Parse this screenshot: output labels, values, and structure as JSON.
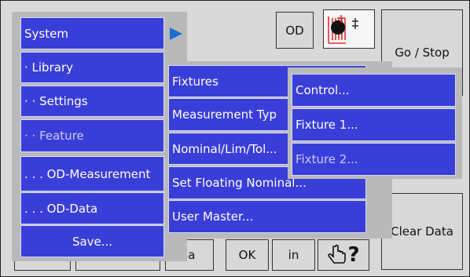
{
  "main_menu": {
    "items": [
      {
        "label": "System"
      },
      {
        "label": "· Library"
      },
      {
        "label": "· · Settings"
      },
      {
        "label": "· · Feature"
      },
      {
        "label": ". . . OD-Measurement"
      },
      {
        "label": ". . . OD-Data"
      },
      {
        "label": "Save..."
      }
    ]
  },
  "sub_menu": {
    "items": [
      {
        "label": "Fixtures"
      },
      {
        "label": "Measurement Typ"
      },
      {
        "label": "Nominal/Lim/Tol..."
      },
      {
        "label": "Set Floating Nominal..."
      },
      {
        "label": "User Master..."
      }
    ]
  },
  "fixture_menu": {
    "items": [
      {
        "label": "Control..."
      },
      {
        "label": "Fixture 1..."
      },
      {
        "label": "Fixture 2..."
      }
    ]
  },
  "toolbar": {
    "od_label": "OD",
    "go_stop_label": "Go / Stop",
    "clear_data_label": "Clear Data",
    "ba_label": "Ba",
    "ok_label": "OK",
    "in_label": "in",
    "help_label": "?"
  },
  "colors": {
    "menu_blue": "#3a3ed8",
    "menu_border": "#d8dcff",
    "arrow_blue": "#1f6fd0",
    "background_gray": "#d9d9d9"
  }
}
